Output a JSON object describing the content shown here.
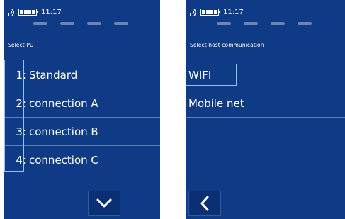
{
  "left": {
    "status": {
      "time": "11:17"
    },
    "subtitle": "Select PU",
    "items": [
      {
        "num": "1:",
        "label": "Standard"
      },
      {
        "num": "2:",
        "label": "connection A"
      },
      {
        "num": "3:",
        "label": "connection B"
      },
      {
        "num": "4:",
        "label": "connection C"
      }
    ],
    "bottom_button_icon": "chevron-down-icon"
  },
  "right": {
    "status": {
      "time": "11:17"
    },
    "subtitle": "Select host communication",
    "items": [
      {
        "label": "WIFI"
      },
      {
        "label": "Mobile net"
      }
    ],
    "bottom_button_icon": "chevron-left-icon"
  },
  "colors": {
    "screen_bg": "#0f3a85",
    "focus_border": "#8ec1ff",
    "separator": "#5f7fb4"
  }
}
